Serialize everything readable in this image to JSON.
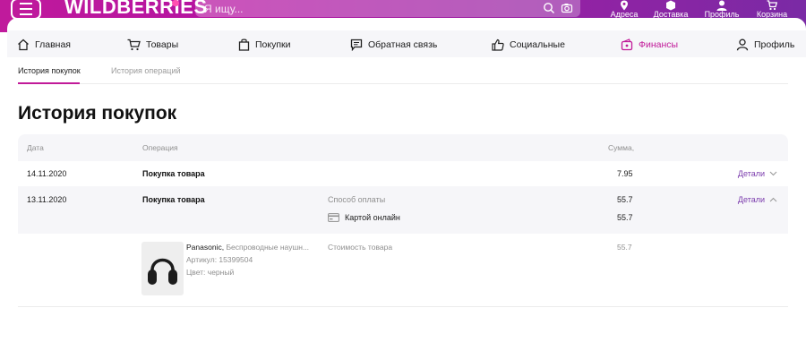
{
  "header": {
    "logo": "WILDBERRIES",
    "search_placeholder": "Я ищу...",
    "nav": [
      {
        "label": "Адреса",
        "icon": "map-pin-icon"
      },
      {
        "label": "Доставка",
        "icon": "box-icon"
      },
      {
        "label": "Профиль",
        "icon": "user-icon"
      },
      {
        "label": "Корзина",
        "icon": "cart-icon"
      }
    ]
  },
  "main_nav": [
    {
      "label": "Главная",
      "icon": "home-icon"
    },
    {
      "label": "Товары",
      "icon": "cart-icon"
    },
    {
      "label": "Покупки",
      "icon": "bag-icon"
    },
    {
      "label": "Обратная связь",
      "icon": "chat-icon"
    },
    {
      "label": "Социальные",
      "icon": "thumbs-up-icon"
    },
    {
      "label": "Финансы",
      "icon": "wallet-icon",
      "active": true
    },
    {
      "label": "Профиль",
      "icon": "user-icon"
    }
  ],
  "sub_tabs": [
    {
      "label": "История покупок",
      "active": true
    },
    {
      "label": "История операций",
      "active": false
    }
  ],
  "page_title": "История покупок",
  "table": {
    "headers": {
      "date": "Дата",
      "operation": "Операция",
      "amount": "Сумма,"
    },
    "rows": [
      {
        "date": "14.11.2020",
        "operation": "Покупка товара",
        "amount": "7.95",
        "details": "Детали"
      },
      {
        "date": "13.11.2020",
        "operation": "Покупка товара",
        "amount": "55.7",
        "details": "Детали",
        "payment_label": "Способ оплаты",
        "payment_method": "Картой онлайн",
        "payment_amount": "55.7"
      }
    ],
    "product": {
      "brand": "Panasonic,",
      "name": "Беспроводные наушн...",
      "article": "Артикул: 15399504",
      "color": "Цвет: черный",
      "cost_label": "Стоимость товара",
      "cost": "55.7"
    }
  },
  "colors": {
    "brand_gradient_start": "#c01a9c",
    "brand_gradient_end": "#7a2aa5",
    "accent": "#c11a99",
    "link": "#7b3cad"
  }
}
